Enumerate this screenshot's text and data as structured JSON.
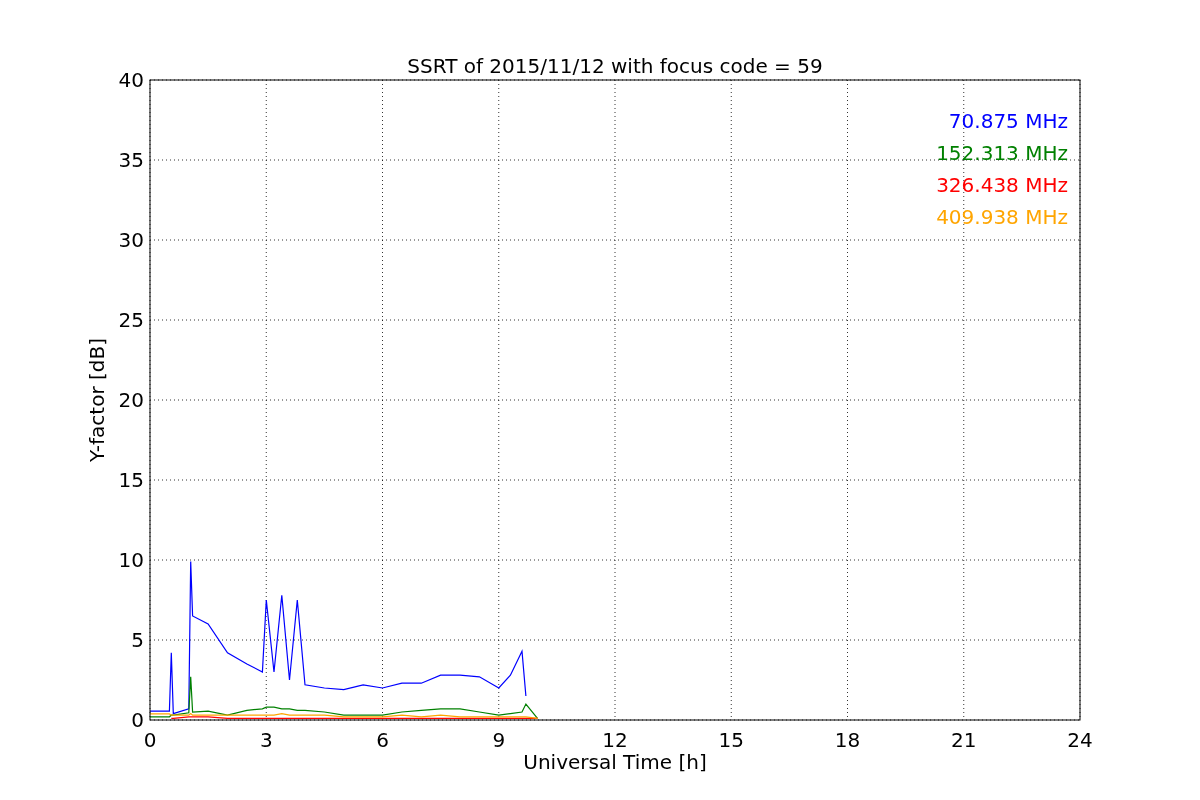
{
  "figure": {
    "chart_data": {
      "type": "line",
      "title": "SSRT of 2015/11/12 with focus code = 59",
      "xlabel": "Universal Time [h]",
      "ylabel": "Y-factor [dB]",
      "x": [
        0,
        0.5,
        0.55,
        0.6,
        1.0,
        1.05,
        1.1,
        1.5,
        2,
        2.5,
        2.9,
        3.0,
        3.2,
        3.4,
        3.6,
        3.8,
        4.0,
        4.5,
        5,
        5.5,
        6,
        6.5,
        7,
        7.5,
        8,
        8.5,
        9,
        9.3,
        9.6,
        9.7,
        10
      ],
      "series": [
        {
          "name": "70.875 MHz",
          "color": "#0000ff",
          "values": [
            0.55,
            0.55,
            4.2,
            0.4,
            0.7,
            9.9,
            6.5,
            6.0,
            4.2,
            3.5,
            3.0,
            7.5,
            3.0,
            7.8,
            2.5,
            7.5,
            2.2,
            2.0,
            1.9,
            2.2,
            2.0,
            2.3,
            2.3,
            2.8,
            2.8,
            2.7,
            2.0,
            2.8,
            4.3,
            1.5,
            null
          ]
        },
        {
          "name": "152.313 MHz",
          "color": "#008000",
          "values": [
            0.2,
            0.2,
            0.3,
            0.3,
            0.45,
            2.7,
            0.5,
            0.55,
            0.3,
            0.6,
            0.7,
            0.8,
            0.8,
            0.7,
            0.7,
            0.6,
            0.6,
            0.5,
            0.3,
            0.3,
            0.3,
            0.5,
            0.6,
            0.7,
            0.7,
            0.5,
            0.3,
            0.4,
            0.5,
            1.0,
            0.1
          ]
        },
        {
          "name": "326.438 MHz",
          "color": "#ff0000",
          "values": [
            null,
            null,
            0.1,
            0.1,
            0.2,
            0.2,
            0.2,
            0.2,
            0.1,
            0.1,
            0.1,
            0.1,
            0.1,
            0.1,
            0.1,
            0.1,
            0.1,
            0.1,
            0.1,
            0.1,
            0.1,
            0.1,
            0.1,
            0.1,
            0.1,
            0.1,
            0.1,
            0.1,
            0.1,
            0.1,
            0.1
          ]
        },
        {
          "name": "409.938 MHz",
          "color": "#ffa500",
          "values": [
            0.38,
            0.38,
            0.3,
            0.3,
            0.3,
            0.4,
            0.3,
            0.3,
            0.3,
            0.3,
            0.3,
            0.3,
            0.3,
            0.4,
            0.3,
            0.3,
            0.3,
            0.3,
            0.2,
            0.2,
            0.2,
            0.3,
            0.2,
            0.3,
            0.2,
            0.2,
            0.2,
            0.2,
            0.2,
            0.2,
            0.1
          ]
        }
      ],
      "grid": true,
      "xlim": [
        0,
        24
      ],
      "ylim": [
        0,
        40
      ],
      "xticks": [
        0,
        3,
        6,
        9,
        12,
        15,
        18,
        21,
        24
      ],
      "yticks": [
        0,
        5,
        10,
        15,
        20,
        25,
        30,
        35,
        40
      ]
    }
  }
}
